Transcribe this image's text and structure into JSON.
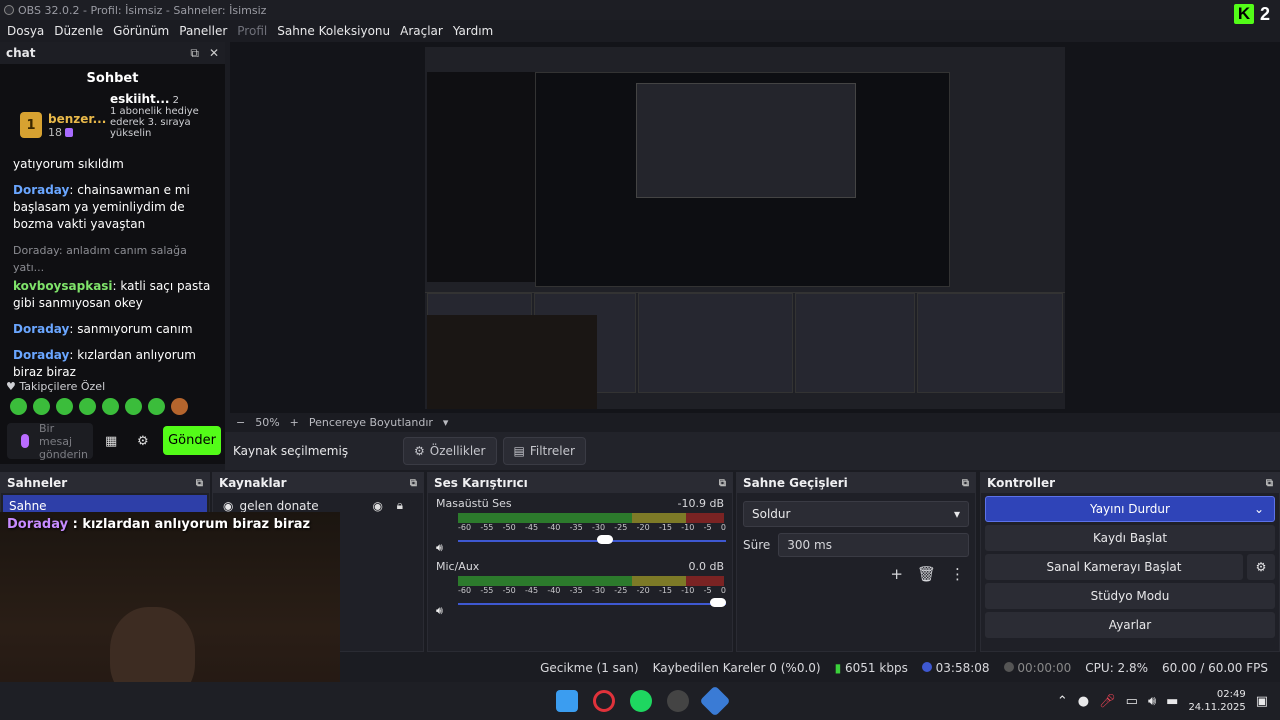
{
  "window": {
    "title": "OBS 32.0.2 - Profil: İsimsiz - Sahneler: İsimsiz"
  },
  "menu": [
    "Dosya",
    "Düzenle",
    "Görünüm",
    "Paneller",
    "Profil",
    "Sahne Koleksiyonu",
    "Araçlar",
    "Yardım"
  ],
  "kick": {
    "viewers": "2"
  },
  "chat": {
    "dock_title": "chat",
    "heading": "Sohbet",
    "gifter1": {
      "rank": "1",
      "name": "benzer...",
      "count": "18"
    },
    "gifter2": {
      "rank": "2",
      "name": "eskiiht...",
      "count": "2",
      "text": "1 abonelik hediye ederek 3. sıraya yükselin"
    },
    "messages": [
      {
        "user": "",
        "text": "yatıyorum sıkıldım"
      },
      {
        "user": "Doraday",
        "text": "chainsawman e mi başlasam ya yeminliydim de bozma vakti yavaştan"
      },
      {
        "reply": "Doraday: anladım canım salağa yatı...",
        "user": "kovboysapkasi",
        "text": "katli saçı pasta gibi sanmıyosan okey"
      },
      {
        "user": "Doraday",
        "text": "sanmıyorum canım"
      },
      {
        "user": "Doraday",
        "text": "kızlardan anlıyorum biraz biraz"
      }
    ],
    "followers_label": "Takipçilere Özel",
    "input_placeholder": "Bir mesaj gönderin",
    "send_label": "Gönder"
  },
  "preview": {
    "zoom": "50%",
    "fit_label": "Pencereye Boyutlandır"
  },
  "context": {
    "no_source": "Kaynak seçilmemiş",
    "properties": "Özellikler",
    "filters": "Filtreler"
  },
  "scenes": {
    "title": "Sahneler",
    "items": [
      "Sahne"
    ]
  },
  "sources": {
    "title": "Kaynaklar",
    "items": [
      "gelen donate"
    ]
  },
  "mixer": {
    "title": "Ses Karıştırıcı",
    "channels": [
      {
        "name": "Masaüstü Ses",
        "db": "-10.9 dB",
        "level": 0.55
      },
      {
        "name": "Mic/Aux",
        "db": "0.0 dB",
        "level": 1.0
      }
    ],
    "ticks": [
      "-60",
      "-55",
      "-50",
      "-45",
      "-40",
      "-35",
      "-30",
      "-25",
      "-20",
      "-15",
      "-10",
      "-5",
      "0"
    ]
  },
  "transitions": {
    "title": "Sahne Geçişleri",
    "selected": "Soldur",
    "duration_label": "Süre",
    "duration": "300 ms"
  },
  "controls": {
    "title": "Kontroller",
    "stream": "Yayını Durdur",
    "record": "Kaydı Başlat",
    "virtualcam": "Sanal Kamerayı Başlat",
    "studio": "Stüdyo Modu",
    "settings": "Ayarlar"
  },
  "status": {
    "delay": "Gecikme (1 san)",
    "dropped": "Kaybedilen Kareler 0 (%0.0)",
    "bitrate": "6051 kbps",
    "stream_time": "03:58:08",
    "rec_time": "00:00:00",
    "cpu": "CPU: 2.8%",
    "fps": "60.00 / 60.00 FPS"
  },
  "overlay": {
    "user": "Doraday",
    "text": " : kızlardan anlıyorum biraz biraz"
  },
  "clock": {
    "time": "02:49",
    "date": "24.11.2025"
  }
}
